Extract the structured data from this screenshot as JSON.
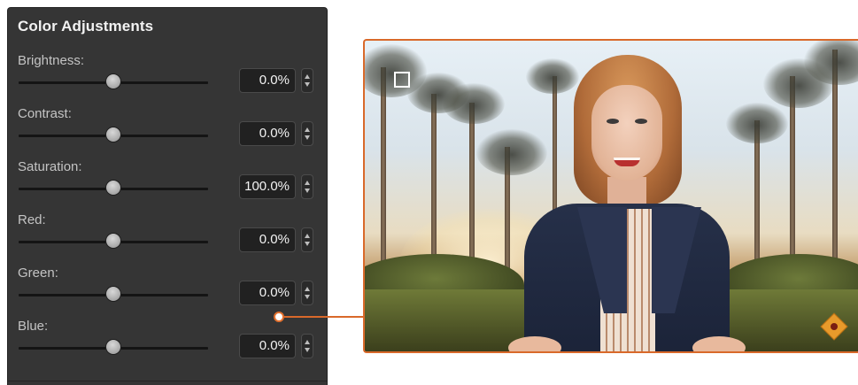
{
  "panel": {
    "title": "Color Adjustments",
    "controls": [
      {
        "label": "Brightness:",
        "value": "0.0%",
        "slider_fraction": 0.5
      },
      {
        "label": "Contrast:",
        "value": "0.0%",
        "slider_fraction": 0.5
      },
      {
        "label": "Saturation:",
        "value": "100.0%",
        "slider_fraction": 0.5
      },
      {
        "label": "Red:",
        "value": "0.0%",
        "slider_fraction": 0.5
      },
      {
        "label": "Green:",
        "value": "0.0%",
        "slider_fraction": 0.5
      },
      {
        "label": "Blue:",
        "value": "0.0%",
        "slider_fraction": 0.5
      }
    ]
  },
  "colors": {
    "panel_bg": "#353535",
    "accent_orange": "#d9692a",
    "value_box_bg": "#212121"
  },
  "preview": {
    "icons": [
      "safe-area-marker-icon",
      "warning-diamond-icon"
    ]
  }
}
